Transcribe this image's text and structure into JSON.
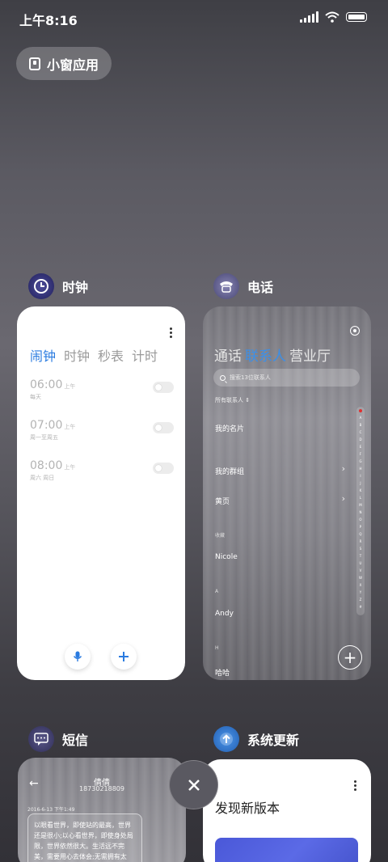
{
  "status_bar": {
    "time": "上午8:16"
  },
  "mini_window": {
    "label": "小窗应用"
  },
  "apps": {
    "clock": {
      "name": "时钟",
      "tabs": [
        "闹钟",
        "时钟",
        "秒表",
        "计时"
      ],
      "alarms": [
        {
          "time": "06:00",
          "ampm": "上午",
          "repeat": "每天"
        },
        {
          "time": "07:00",
          "ampm": "上午",
          "repeat": "周一至周五"
        },
        {
          "time": "08:00",
          "ampm": "上午",
          "repeat": "周六 周日"
        }
      ]
    },
    "phone": {
      "name": "电话",
      "tabs": [
        "通话",
        "联系人",
        "营业厅"
      ],
      "search_placeholder": "搜索13位联系人",
      "filter": "所有联系人",
      "my_card": "我的名片",
      "my_groups": "我的群组",
      "yellow_pages": "黄页",
      "section_starred": "收藏",
      "section_a": "A",
      "section_h": "H",
      "contacts": [
        "Nicole",
        "Andy",
        "哈哈"
      ],
      "index_letters": [
        "A",
        "B",
        "C",
        "D",
        "E",
        "F",
        "G",
        "H",
        "I",
        "J",
        "K",
        "L",
        "M",
        "N",
        "O",
        "P",
        "Q",
        "R",
        "S",
        "T",
        "U",
        "V",
        "W",
        "X",
        "Y",
        "Z",
        "#"
      ]
    },
    "sms": {
      "name": "短信",
      "contact_name": "倩倩",
      "contact_number": "18730218809",
      "date": "2016-6-13 下午1:49",
      "message": "以眼看世界，即使站的最高，世界还是很小;以心看世界，即使身处局限，世界依然很大。生活远不完美，需要用心去体会;无需拥有太"
    },
    "update": {
      "name": "系统更新",
      "title": "发现新版本"
    }
  },
  "colors": {
    "accent_blue": "#2a7be0",
    "clock_icon": "#3b3a8c",
    "phone_icon": "#7d7aa8",
    "sms_icon": "#4c4a7a",
    "update_icon": "#3b86e0"
  }
}
